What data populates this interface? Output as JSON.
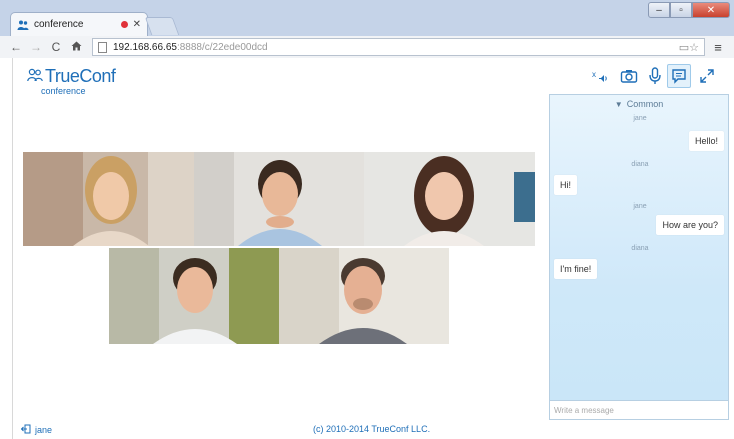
{
  "browser": {
    "tab_title": "conference",
    "address_host": "192.168.66.65",
    "address_path": ":8888/c/22ede00dcd"
  },
  "app": {
    "logo_text": "TrueConf",
    "logo_sub": "conference",
    "controls": [
      "mic-muted-icon",
      "camera-icon",
      "microphone-icon",
      "chat-icon",
      "fullscreen-icon"
    ]
  },
  "chat": {
    "channel": "Common",
    "messages": [
      {
        "author": "jane",
        "text": "Hello!",
        "side": "right"
      },
      {
        "author": "diana",
        "text": "Hi!",
        "side": "left"
      },
      {
        "author": "jane",
        "text": "How are you?",
        "side": "right"
      },
      {
        "author": "diana",
        "text": "I'm fine!",
        "side": "left"
      }
    ],
    "input_placeholder": "Write a message"
  },
  "footer": {
    "user": "jane",
    "copyright": "(c) 2010-2014 TrueConf LLC."
  },
  "colors": {
    "accent": "#1f6fb8",
    "chat_bg": "#cfe8f9"
  }
}
